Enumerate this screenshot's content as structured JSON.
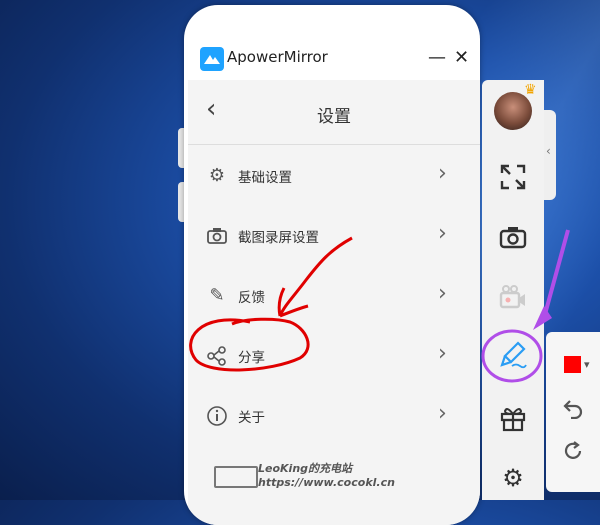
{
  "window": {
    "title": "ApowerMirror",
    "minimize_symbol": "—",
    "close_symbol": "✕"
  },
  "settings": {
    "title": "设置",
    "back_symbol": "‹",
    "items": [
      {
        "label": "基础设置",
        "icon": "gear-icon"
      },
      {
        "label": "截图录屏设置",
        "icon": "camera-icon"
      },
      {
        "label": "反馈",
        "icon": "pen-icon"
      },
      {
        "label": "分享",
        "icon": "share-icon"
      },
      {
        "label": "关于",
        "icon": "info-icon"
      }
    ],
    "chevron_symbol": "›"
  },
  "toolbar": {
    "tools": [
      "fullscreen-icon",
      "screenshot-icon",
      "record-video-icon",
      "draw-icon",
      "gift-icon",
      "settings-icon"
    ],
    "collapse_symbol": "‹"
  },
  "draw_panel": {
    "color": "#ff0000",
    "tools": [
      "undo-icon",
      "redo-icon"
    ]
  },
  "watermark": {
    "line1": "LeoKing的充电站",
    "line2": "https://www.cocokl.cn"
  },
  "colors": {
    "accent": "#1fa3ff",
    "annotation_red": "#e00000",
    "annotation_purple": "#b04ee8"
  }
}
